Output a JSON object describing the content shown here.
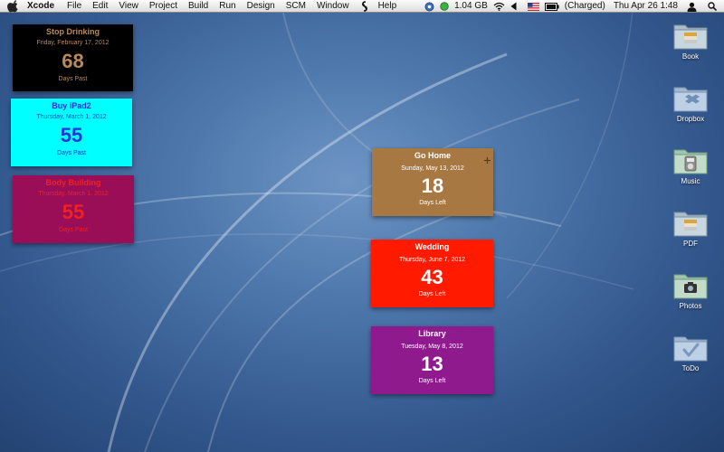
{
  "menubar": {
    "app_name": "Xcode",
    "items": [
      "File",
      "Edit",
      "View",
      "Project",
      "Build",
      "Run",
      "Design",
      "SCM",
      "Window",
      "Help"
    ],
    "memory": "1.04 GB",
    "battery": "(Charged)",
    "datetime": "Thu Apr 26  1:48",
    "icons": [
      "apple-icon",
      "script-icon",
      "monitor-icon",
      "status-icon",
      "wifi-icon",
      "volume-icon",
      "flag-icon",
      "battery-icon",
      "user-icon",
      "search-icon"
    ]
  },
  "widgets": [
    {
      "title": "Stop Drinking",
      "date": "Friday, February 17, 2012",
      "count": "68",
      "status": "Days Past",
      "bg": "#000000",
      "fg": "#b8895a"
    },
    {
      "title": "Buy iPad2",
      "date": "Thursday, March 1, 2012",
      "count": "55",
      "status": "Days Past",
      "bg": "#00ffff",
      "fg": "#2233dd"
    },
    {
      "title": "Body Building",
      "date": "Thursday, March 1, 2012",
      "count": "55",
      "status": "Days Past",
      "bg": "#990e56",
      "fg": "#ee2222"
    },
    {
      "title": "Go Home",
      "date": "Sunday, May 13, 2012",
      "count": "18",
      "status": "Days Left",
      "bg": "#a87842",
      "fg": "#ffffff"
    },
    {
      "title": "Wedding",
      "date": "Thursday, June 7, 2012",
      "count": "43",
      "status": "Days Left",
      "bg": "#ff1a00",
      "fg": "#ffffff"
    },
    {
      "title": "Library",
      "date": "Tuesday, May 8, 2012",
      "count": "13",
      "status": "Days Left",
      "bg": "#8e1a8e",
      "fg": "#ffffff"
    }
  ],
  "folders": [
    {
      "label": "Book",
      "icon": "book-folder-icon"
    },
    {
      "label": "Dropbox",
      "icon": "dropbox-folder-icon"
    },
    {
      "label": "Music",
      "icon": "music-folder-icon"
    },
    {
      "label": "PDF",
      "icon": "pdf-folder-icon"
    },
    {
      "label": "Photos",
      "icon": "photos-folder-icon"
    },
    {
      "label": "ToDo",
      "icon": "todo-folder-icon"
    }
  ]
}
